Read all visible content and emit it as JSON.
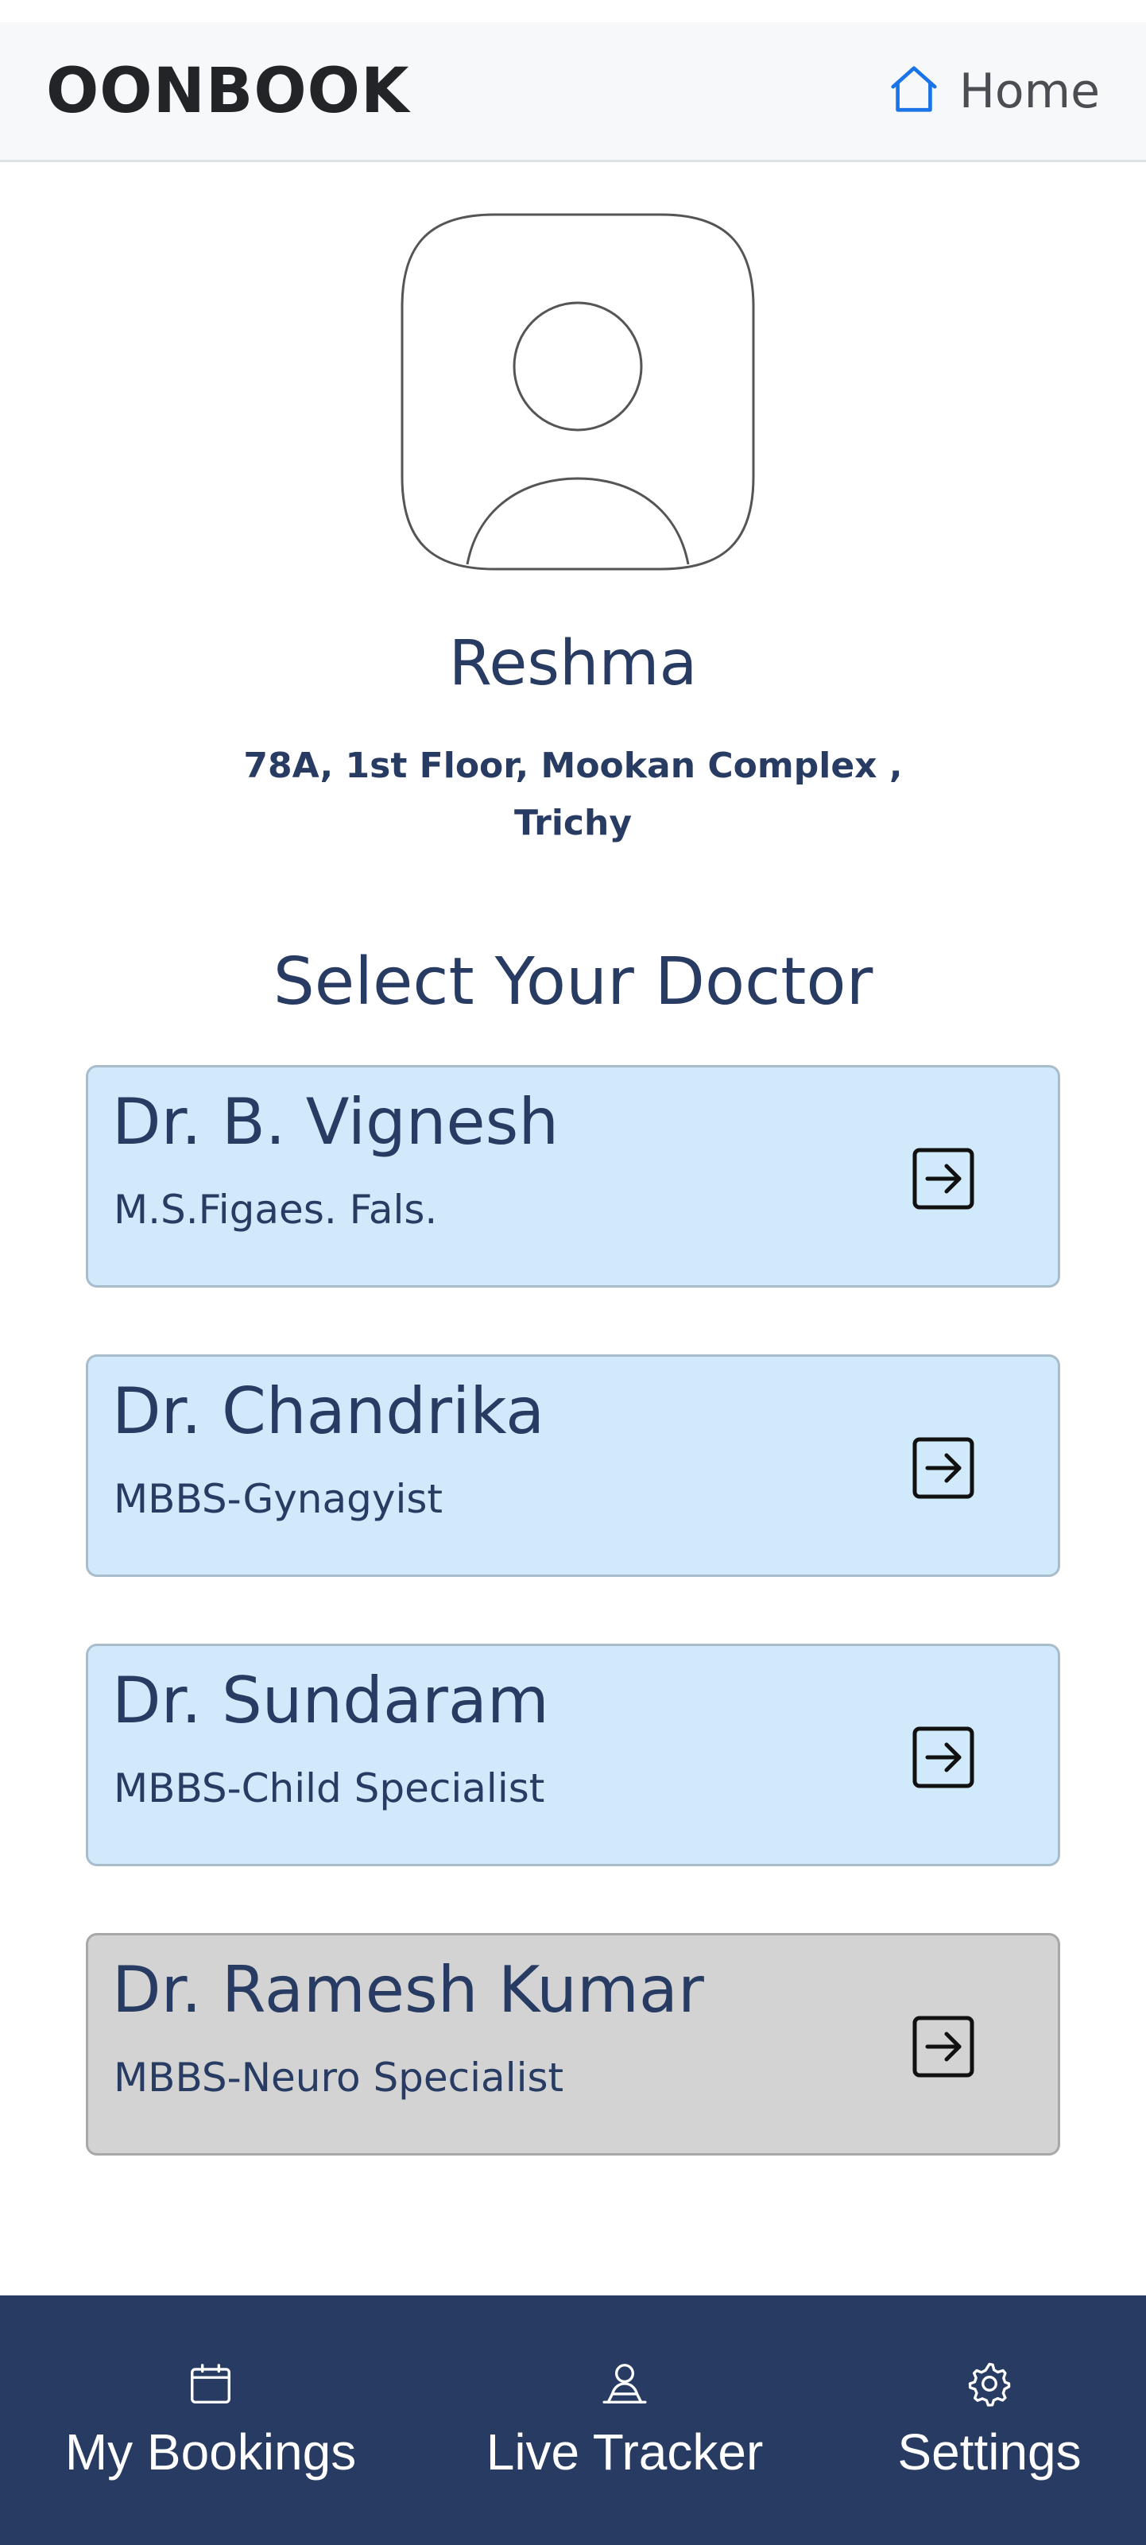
{
  "header": {
    "brand": "OONBOOK",
    "home_label": "Home",
    "home_icon": "home-icon",
    "accent_color": "#1a73e8"
  },
  "profile": {
    "avatar_icon": "user-avatar-icon",
    "name": "Reshma",
    "address_line1": "78A, 1st Floor, Mookan Complex ,",
    "address_line2": "Trichy"
  },
  "section_title": "Select Your Doctor",
  "doctors": [
    {
      "name": "Dr. B. Vignesh",
      "qualification": "M.S.Figaes. Fals.",
      "status": "available",
      "icon": "enter-arrow-icon"
    },
    {
      "name": "Dr. Chandrika",
      "qualification": "MBBS-Gynagyist",
      "status": "available",
      "icon": "enter-arrow-icon"
    },
    {
      "name": "Dr. Sundaram",
      "qualification": "MBBS-Child Specialist",
      "status": "available",
      "icon": "enter-arrow-icon"
    },
    {
      "name": "Dr. Ramesh Kumar",
      "qualification": "MBBS-Neuro Specialist",
      "status": "unavailable",
      "icon": "enter-arrow-icon"
    }
  ],
  "bottom_nav": {
    "items": [
      {
        "label": "My Bookings",
        "icon": "calendar-icon"
      },
      {
        "label": "Live Tracker",
        "icon": "location-person-icon"
      },
      {
        "label": "Settings",
        "icon": "gear-icon"
      }
    ]
  },
  "colors": {
    "primary_navy": "#283b62",
    "card_available": "#d0e9fb",
    "card_unavailable": "#d3d3d3",
    "header_bg": "#f7f8f9"
  }
}
